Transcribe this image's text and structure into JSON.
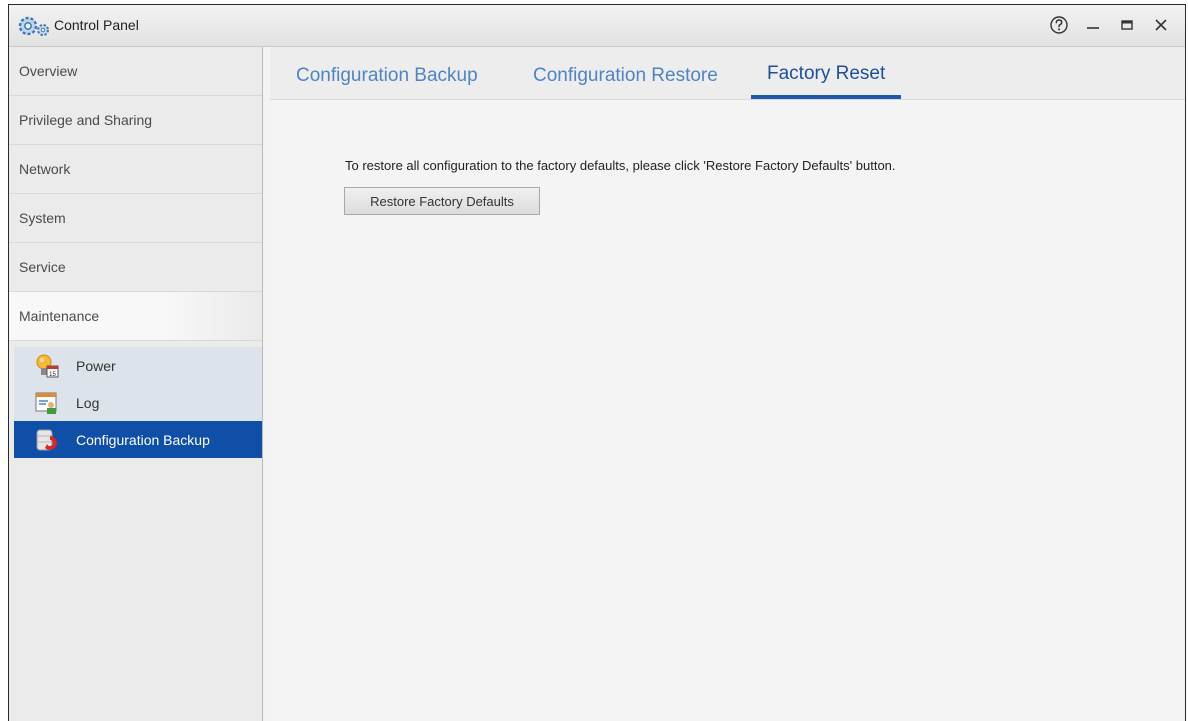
{
  "window": {
    "title": "Control Panel",
    "icons": {
      "app": "control-panel-gears-icon",
      "help": "help-icon",
      "minimize": "minimize-icon",
      "maximize": "maximize-icon",
      "close": "close-icon"
    }
  },
  "sidebar": {
    "items": [
      {
        "label": "Overview"
      },
      {
        "label": "Privilege and Sharing"
      },
      {
        "label": "Network"
      },
      {
        "label": "System"
      },
      {
        "label": "Service"
      },
      {
        "label": "Maintenance"
      }
    ],
    "subitems": [
      {
        "label": "Power",
        "icon": "power-bulb-icon"
      },
      {
        "label": "Log",
        "icon": "log-icon"
      },
      {
        "label": "Configuration Backup",
        "icon": "configuration-backup-icon",
        "selected": true
      }
    ]
  },
  "tabs": [
    {
      "label": "Configuration Backup"
    },
    {
      "label": "Configuration Restore"
    },
    {
      "label": "Factory Reset",
      "active": true
    }
  ],
  "content": {
    "message": "To restore all configuration to the factory defaults, please click 'Restore Factory Defaults' button.",
    "button_label": "Restore Factory Defaults"
  },
  "colors": {
    "accent": "#0f4fa8",
    "tab_text": "#4f84c4",
    "active_tab_underline": "#1f5aa8"
  }
}
